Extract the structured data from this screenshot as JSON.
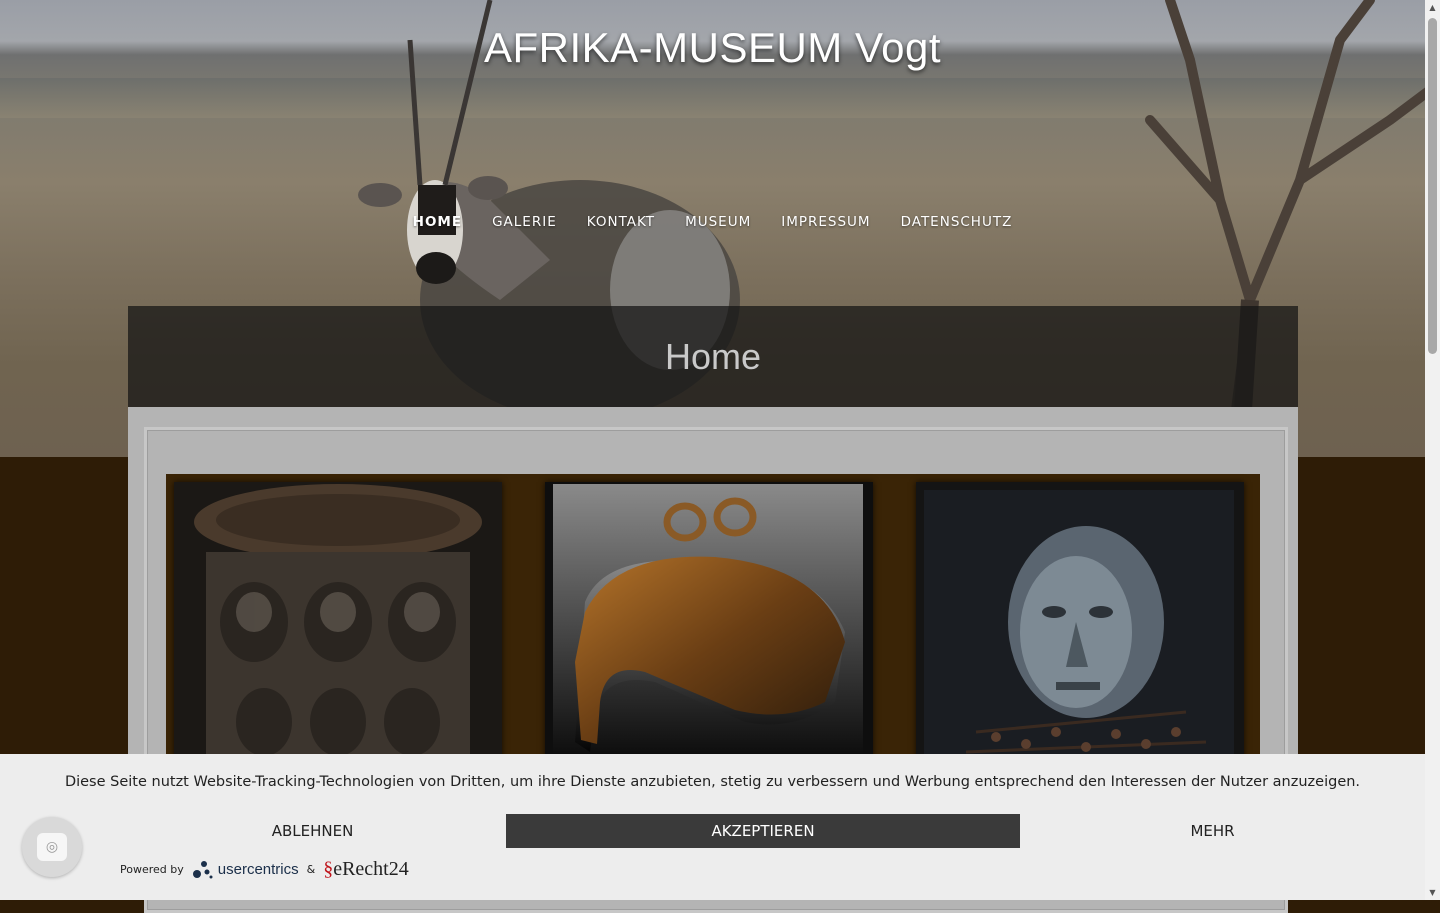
{
  "site": {
    "title": "AFRIKA-MUSEUM Vogt"
  },
  "nav": {
    "items": [
      {
        "label": "HOME",
        "active": true
      },
      {
        "label": "GALERIE"
      },
      {
        "label": "KONTAKT"
      },
      {
        "label": "MUSEUM"
      },
      {
        "label": "IMPRESSUM"
      },
      {
        "label": "DATENSCHUTZ"
      }
    ]
  },
  "page": {
    "heading": "Home"
  },
  "gallery": {
    "items": [
      {
        "icon": "carved-stool-image"
      },
      {
        "icon": "bronze-bracelet-image"
      },
      {
        "icon": "nail-figure-image"
      }
    ]
  },
  "consent": {
    "message": "Diese Seite nutzt Website-Tracking-Technologien von Dritten, um ihre Dienste anzubieten, stetig zu verbessern und Werbung entsprechend den Interessen der Nutzer anzuzeigen.",
    "reject_label": "ABLEHNEN",
    "accept_label": "AKZEPTIEREN",
    "more_label": "MEHR",
    "powered_by": "Powered by",
    "usercentrics": "usercentrics",
    "ampersand": "&",
    "erecht": "eRecht24",
    "fingerprint_icon": "fingerprint-icon"
  },
  "colors": {
    "accept_bg": "#3a3a3a",
    "consent_bg": "#ededed",
    "gallery_bg": "#3a2406",
    "page_bg": "#2e1c06"
  }
}
